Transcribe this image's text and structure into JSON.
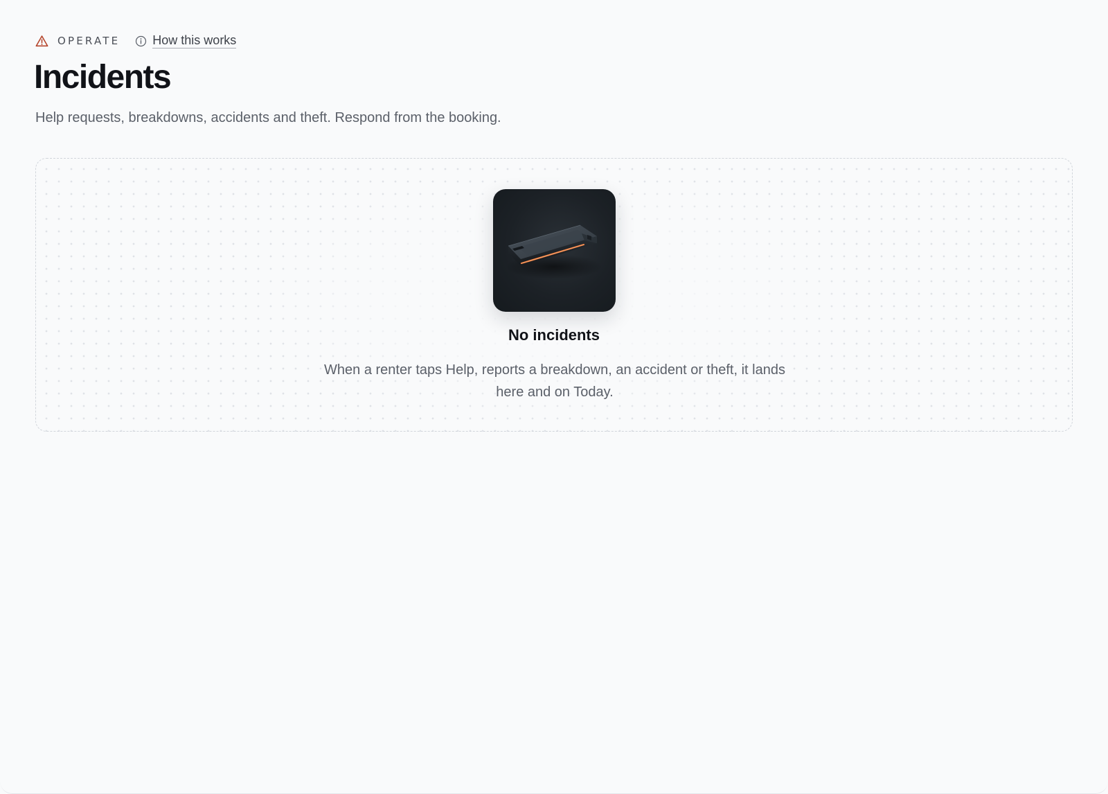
{
  "header": {
    "section_label": "OPERATE",
    "section_icon": "warning-icon",
    "help_icon": "info-icon",
    "help_link_label": "How this works",
    "title": "Incidents",
    "subtitle": "Help requests, breakdowns, accidents and theft. Respond from the booking."
  },
  "empty_state": {
    "illustration": "device-illustration",
    "title": "No incidents",
    "description": "When a renter taps Help, reports a breakdown, an accident or theft, it lands here and on Today."
  },
  "colors": {
    "warning": "#b5452c",
    "background": "#f9fafb",
    "text_primary": "#111318",
    "text_secondary": "#5b6069",
    "device_glow": "#e8783d"
  }
}
